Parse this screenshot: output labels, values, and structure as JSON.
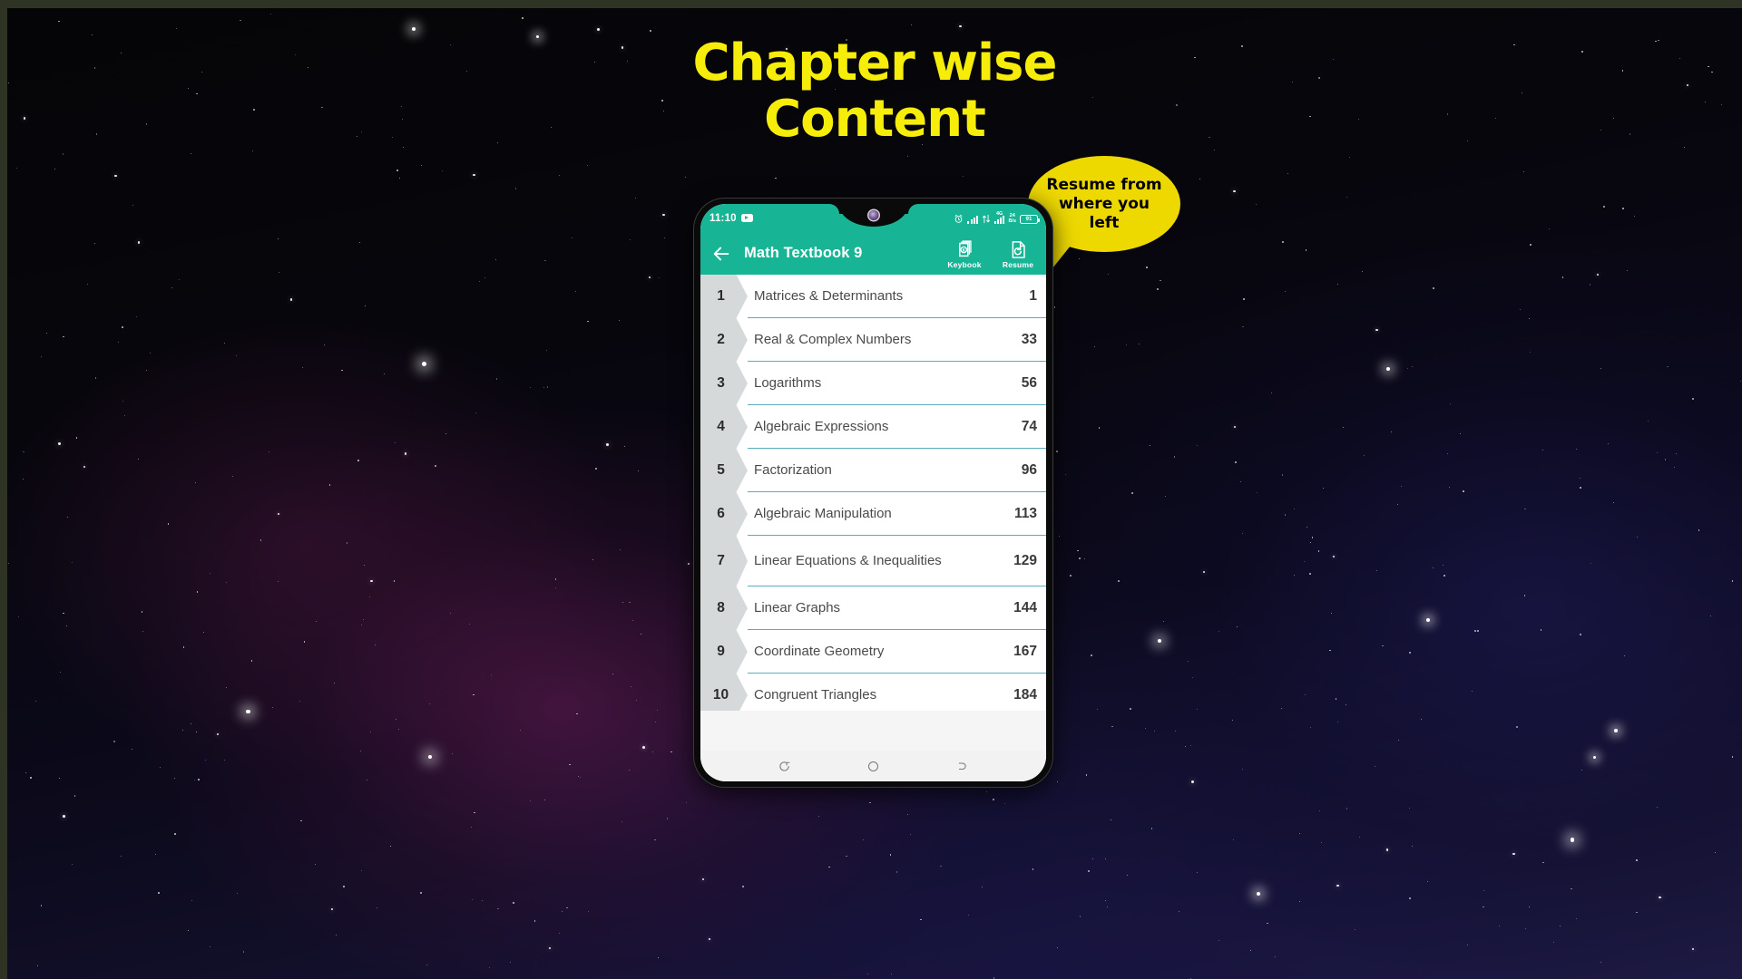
{
  "headline": "Chapter wise\nContent",
  "callout": {
    "text": "Resume from\nwhere you\nleft",
    "bg_color": "#EDD800",
    "text_color": "#000000"
  },
  "theme": {
    "accent": "#17B596",
    "headline_color": "#F7ED0B",
    "badge_color": "#D6D9DA",
    "divider_color": "#58ADBE"
  },
  "phone": {
    "status_bar": {
      "time": "11:10",
      "youtube_icon": "youtube-icon",
      "alarm_icon": "alarm-clock-icon",
      "signal_icon": "signal-bars-icon",
      "data_arrows_icon": "data-transfer-icon",
      "network_type": "4G",
      "data_rate_value": "24",
      "data_rate_unit": "B/s",
      "battery_level": "91"
    },
    "app_bar": {
      "back_icon": "back-arrow-icon",
      "title": "Math Textbook 9",
      "actions": [
        {
          "icon": "keybook-icon",
          "label": "Keybook"
        },
        {
          "icon": "resume-icon",
          "label": "Resume"
        }
      ]
    },
    "chapters": [
      {
        "number": "1",
        "title": "Matrices & Determinants",
        "page": "1"
      },
      {
        "number": "2",
        "title": "Real & Complex Numbers",
        "page": "33"
      },
      {
        "number": "3",
        "title": "Logarithms",
        "page": "56"
      },
      {
        "number": "4",
        "title": "Algebraic Expressions",
        "page": "74"
      },
      {
        "number": "5",
        "title": "Factorization",
        "page": "96"
      },
      {
        "number": "6",
        "title": "Algebraic Manipulation",
        "page": "113"
      },
      {
        "number": "7",
        "title": "Linear Equations & Inequalities",
        "page": "129"
      },
      {
        "number": "8",
        "title": "Linear Graphs",
        "page": "144"
      },
      {
        "number": "9",
        "title": "Coordinate Geometry",
        "page": "167"
      },
      {
        "number": "10",
        "title": "Congruent Triangles",
        "page": "184"
      }
    ],
    "nav_bar": [
      {
        "icon": "recents-icon"
      },
      {
        "icon": "home-icon"
      },
      {
        "icon": "back-icon"
      }
    ]
  }
}
